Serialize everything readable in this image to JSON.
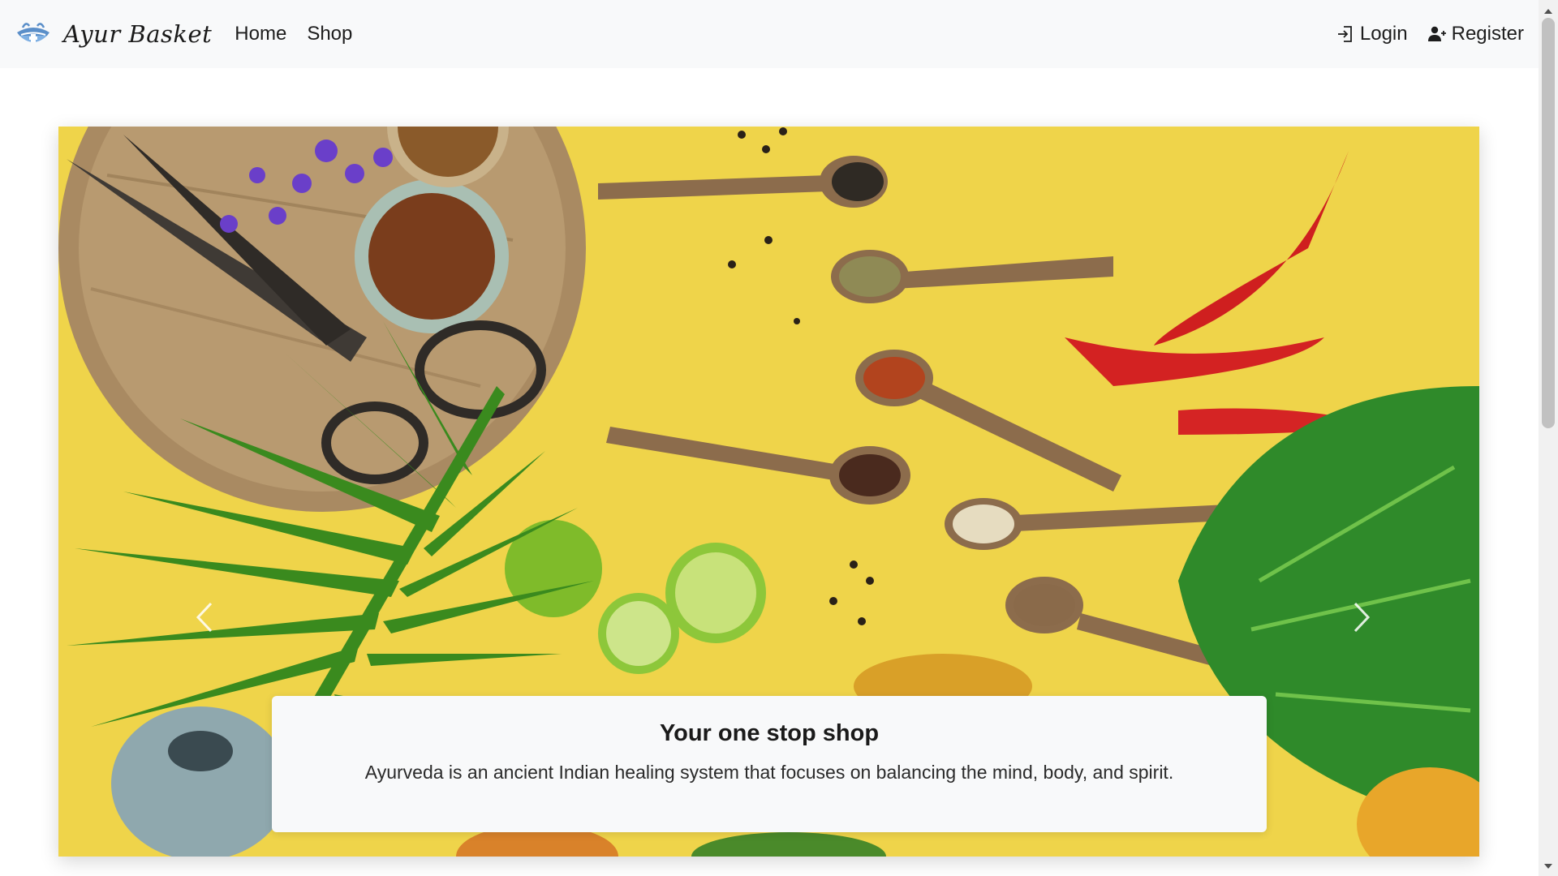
{
  "navbar": {
    "brand_name": "Ayur Basket",
    "links": [
      {
        "label": "Home"
      },
      {
        "label": "Shop"
      }
    ],
    "login_label": "Login",
    "register_label": "Register"
  },
  "hero": {
    "caption_title": "Your one stop shop",
    "caption_text": "Ayurveda is an ancient Indian healing system that focuses on balancing the mind, body, and spirit."
  },
  "icons": {
    "brand": "mortar-bowl-icon",
    "login": "login-arrow-icon",
    "register": "user-plus-icon",
    "prev": "chevron-left-icon",
    "next": "chevron-right-icon"
  },
  "colors": {
    "navbar_bg": "#f8f9fa",
    "hero_yellow": "#efd44a",
    "caption_bg": "#f8f9fa",
    "text": "#212529"
  }
}
